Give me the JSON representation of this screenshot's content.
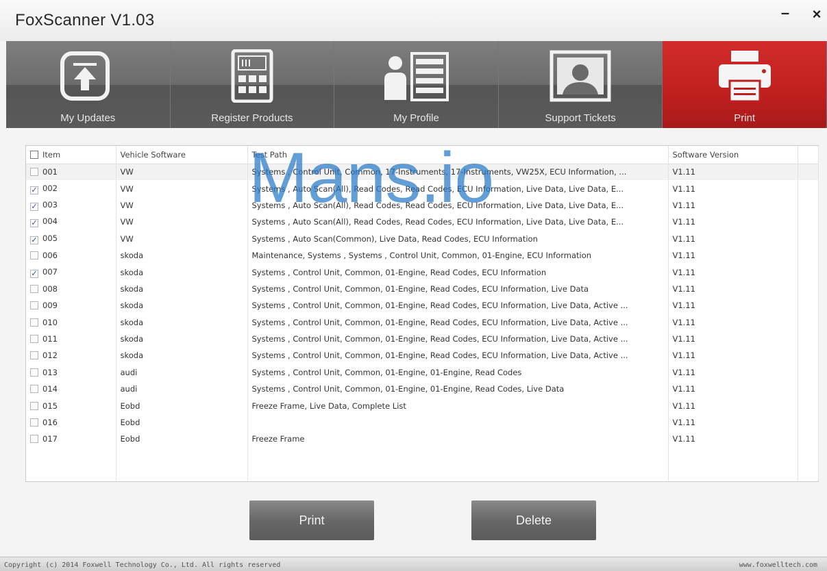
{
  "window": {
    "title": "FoxScanner  V1.03",
    "minimize": "–",
    "close": "×"
  },
  "toolbar": {
    "items": [
      {
        "label": "My Updates",
        "icon": "upload-arrow-icon"
      },
      {
        "label": "Register Products",
        "icon": "calculator-register-icon"
      },
      {
        "label": "My Profile",
        "icon": "profile-list-icon"
      },
      {
        "label": "Support Tickets",
        "icon": "support-portrait-icon"
      },
      {
        "label": "Print",
        "icon": "printer-icon",
        "active": true
      }
    ]
  },
  "table": {
    "headers": {
      "item": "Item",
      "vehicle": "Vehicle Software",
      "path": "Test Path",
      "version": "Software Version"
    },
    "rows": [
      {
        "item": "001",
        "checked": false,
        "vehicle": "VW",
        "path": "Systems , Control Unit, Common, 17-Instruments, 17-Instruments, VW25X, ECU Information, ...",
        "version": "V1.11"
      },
      {
        "item": "002",
        "checked": true,
        "vehicle": "VW",
        "path": "Systems , Auto Scan(All), Read Codes, Read Codes, ECU Information, Live Data, Live Data, E...",
        "version": "V1.11"
      },
      {
        "item": "003",
        "checked": true,
        "vehicle": "VW",
        "path": "Systems , Auto Scan(All), Read Codes, Read Codes, ECU Information, Live Data, Live Data, E...",
        "version": "V1.11"
      },
      {
        "item": "004",
        "checked": true,
        "vehicle": "VW",
        "path": "Systems , Auto Scan(All), Read Codes, Read Codes, ECU Information, Live Data, Live Data, E...",
        "version": "V1.11"
      },
      {
        "item": "005",
        "checked": true,
        "vehicle": "VW",
        "path": "Systems , Auto Scan(Common), Live Data, Read Codes, ECU Information",
        "version": "V1.11"
      },
      {
        "item": "006",
        "checked": false,
        "vehicle": "skoda",
        "path": "Maintenance, Systems , Systems , Control Unit, Common, 01-Engine, ECU Information",
        "version": "V1.11"
      },
      {
        "item": "007",
        "checked": true,
        "vehicle": "skoda",
        "path": "Systems , Control Unit, Common, 01-Engine, Read Codes, ECU Information",
        "version": "V1.11"
      },
      {
        "item": "008",
        "checked": false,
        "vehicle": "skoda",
        "path": "Systems , Control Unit, Common, 01-Engine, Read Codes, ECU Information, Live Data",
        "version": "V1.11"
      },
      {
        "item": "009",
        "checked": false,
        "vehicle": "skoda",
        "path": "Systems , Control Unit, Common, 01-Engine, Read Codes, ECU Information, Live Data, Active ...",
        "version": "V1.11"
      },
      {
        "item": "010",
        "checked": false,
        "vehicle": "skoda",
        "path": "Systems , Control Unit, Common, 01-Engine, Read Codes, ECU Information, Live Data, Active ...",
        "version": "V1.11"
      },
      {
        "item": "011",
        "checked": false,
        "vehicle": "skoda",
        "path": "Systems , Control Unit, Common, 01-Engine, Read Codes, ECU Information, Live Data, Active ...",
        "version": "V1.11"
      },
      {
        "item": "012",
        "checked": false,
        "vehicle": "skoda",
        "path": "Systems , Control Unit, Common, 01-Engine, Read Codes, ECU Information, Live Data, Active ...",
        "version": "V1.11"
      },
      {
        "item": "013",
        "checked": false,
        "vehicle": "audi",
        "path": "Systems , Control Unit, Common, 01-Engine, 01-Engine, Read Codes",
        "version": "V1.11"
      },
      {
        "item": "014",
        "checked": false,
        "vehicle": "audi",
        "path": "Systems , Control Unit, Common, 01-Engine, 01-Engine, Read Codes, Live Data",
        "version": "V1.11"
      },
      {
        "item": "015",
        "checked": false,
        "vehicle": "Eobd",
        "path": "Freeze Frame, Live Data, Complete List",
        "version": "V1.11"
      },
      {
        "item": "016",
        "checked": false,
        "vehicle": "Eobd",
        "path": "",
        "version": "V1.11"
      },
      {
        "item": "017",
        "checked": false,
        "vehicle": "Eobd",
        "path": "Freeze Frame",
        "version": "V1.11"
      }
    ]
  },
  "watermark": "Mans.io",
  "buttons": {
    "print": "Print",
    "delete": "Delete"
  },
  "statusbar": {
    "copyright": "Copyright (c) 2014 Foxwell Technology Co., Ltd. All rights reserved",
    "website": "www.foxwelltech.com"
  },
  "colors": {
    "active_tab": "#c01f1f",
    "toolbar": "#6a6a6a",
    "check": "#2a52a8",
    "watermark": "#2878c8"
  }
}
